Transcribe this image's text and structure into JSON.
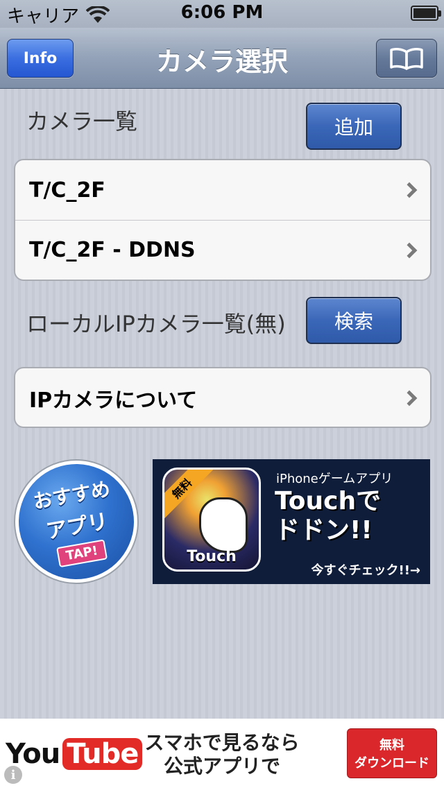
{
  "status_bar": {
    "carrier": "キャリア",
    "time": "6:06 PM"
  },
  "nav": {
    "title": "カメラ選択",
    "info_label": "Info",
    "book_icon": "book-icon"
  },
  "camera_section": {
    "label": "カメラ一覧",
    "add_button": "追加",
    "items": [
      {
        "label": "T/C_2F"
      },
      {
        "label": "T/C_2F - DDNS"
      }
    ]
  },
  "local_section": {
    "label": "ローカルIPカメラ一覧(無)",
    "search_button": "検索"
  },
  "about_section": {
    "items": [
      {
        "label": "IPカメラについて"
      }
    ]
  },
  "recommend": {
    "line1": "おすすめ",
    "line2": "アプリ",
    "tap": "TAP!"
  },
  "game_ad": {
    "free": "無料",
    "icon_text": "Touch",
    "subtitle": "iPhoneゲームアプリ",
    "title_line1": "Touchで",
    "title_line2": "ドドン!!",
    "cta": "今すぐチェック!!→"
  },
  "youtube_ad": {
    "logo_you": "You",
    "logo_tube": "Tube",
    "text_line1": "スマホで見るなら",
    "text_line2": "公式アプリで",
    "button_line1": "無料",
    "button_line2": "ダウンロード"
  },
  "colors": {
    "accent_blue": "#3b67b8",
    "youtube_red": "#e22a27"
  }
}
